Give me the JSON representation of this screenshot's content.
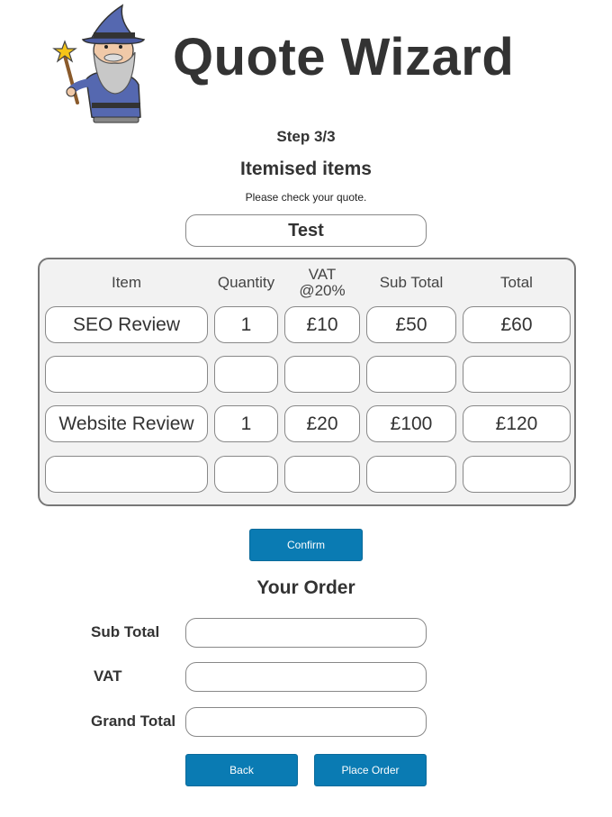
{
  "header": {
    "title": "Quote Wizard"
  },
  "step": "Step 3/3",
  "section_title": "Itemised items",
  "instructions": "Please check your quote.",
  "quote_name": "Test",
  "table": {
    "columns": [
      "Item",
      "Quantity",
      "VAT\n@20%",
      "Sub Total",
      "Total"
    ],
    "rows": [
      [
        "SEO Review",
        "1",
        "£10",
        "£50",
        "£60"
      ],
      [
        "",
        "",
        "",
        "",
        ""
      ],
      [
        "Website Review",
        "1",
        "£20",
        "£100",
        "£120"
      ],
      [
        "",
        "",
        "",
        "",
        ""
      ]
    ]
  },
  "confirm_label": "Confirm",
  "order": {
    "title": "Your Order",
    "subtotal_label": "Sub Total",
    "vat_label": "VAT",
    "grand_total_label": "Grand Total",
    "subtotal_value": "",
    "vat_value": "",
    "grand_total_value": ""
  },
  "back_label": "Back",
  "place_order_label": "Place Order"
}
